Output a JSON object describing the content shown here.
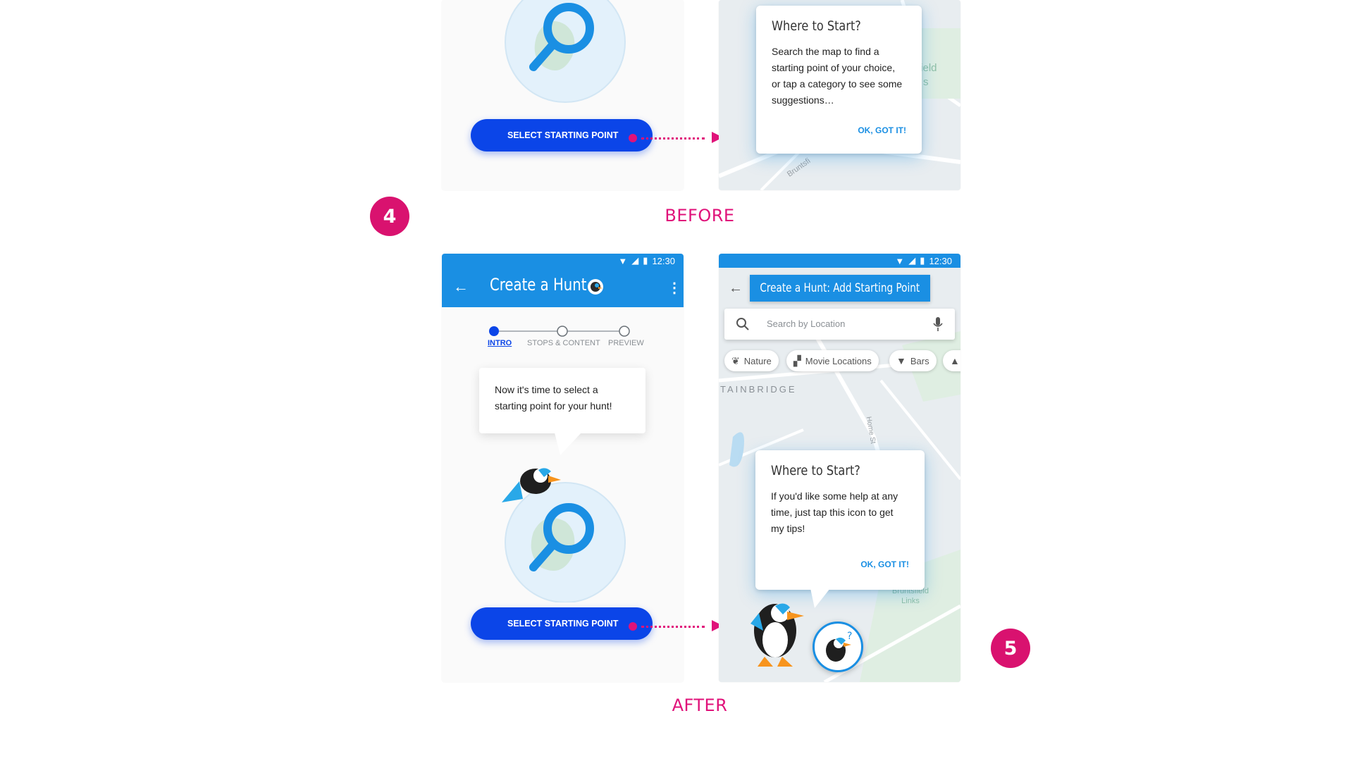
{
  "labels": {
    "before": "BEFORE",
    "after": "AFTER",
    "step4": "4",
    "step5": "5"
  },
  "status": {
    "time": "12:30"
  },
  "before": {
    "button_label": "SELECT STARTING POINT",
    "dialog": {
      "title": "Where to Start?",
      "body": "Search the map to find a starting point of your choice, or tap a category to see some suggestions…",
      "action": "OK, GOT IT!"
    },
    "map_labels": [
      "field",
      "s",
      "Bruntsfi"
    ]
  },
  "after": {
    "left_phone": {
      "title": "Create a Hunt",
      "steps": [
        "INTRO",
        "STOPS & CONTENT",
        "PREVIEW"
      ],
      "active_step": 0,
      "bubble_text": "Now it's time to select a starting point for your hunt!",
      "button_label": "SELECT STARTING POINT"
    },
    "right_phone": {
      "header": "Create a Hunt: Add Starting Point",
      "search_placeholder": "Search by Location",
      "chips": [
        "Nature",
        "Movie Locations",
        "Bars"
      ],
      "map_labels": {
        "district": "TAINBRIDGE",
        "street": "Home St",
        "park": "Bruntsfield Links"
      },
      "dialog": {
        "title": "Where to Start?",
        "body": "If you'd like some help at any time, just tap this icon to get my tips!",
        "action": "OK, GOT IT!"
      }
    }
  },
  "colors": {
    "accent_pink": "#e0127a",
    "app_blue": "#1a8fe3",
    "button_blue": "#0b45e8"
  }
}
